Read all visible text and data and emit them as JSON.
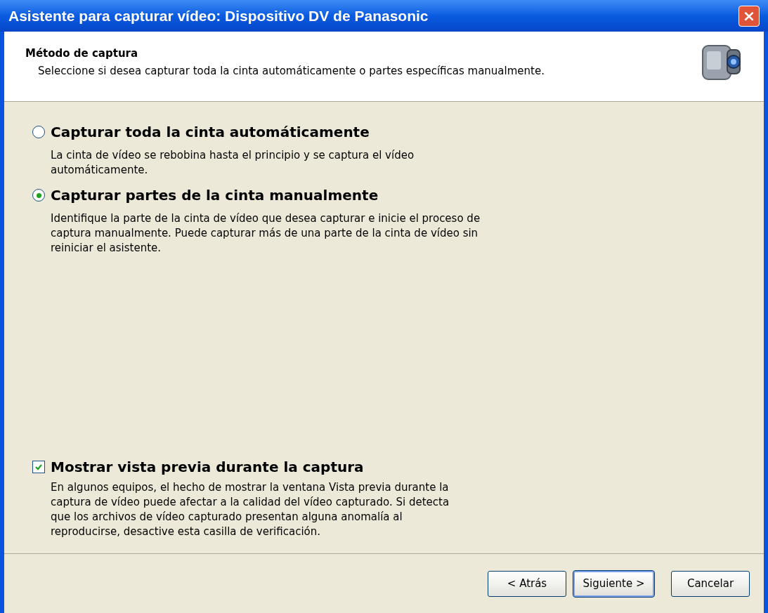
{
  "window": {
    "title": "Asistente para capturar vídeo: Dispositivo DV de Panasonic",
    "close": "×"
  },
  "header": {
    "title": "Método de captura",
    "subtitle": "Seleccione si desea capturar toda la cinta automáticamente o partes específicas manualmente."
  },
  "options": [
    {
      "label": "Capturar toda la cinta automáticamente",
      "description": "La cinta de vídeo se rebobina hasta el principio y se captura el vídeo automáticamente.",
      "selected": false
    },
    {
      "label": "Capturar partes de la cinta manualmente",
      "description": "Identifique la parte de la cinta de vídeo que desea capturar e inicie el proceso de captura manualmente. Puede capturar más de una parte de la cinta de vídeo sin reiniciar el asistente.",
      "selected": true
    }
  ],
  "preview": {
    "label": "Mostrar vista previa durante la captura",
    "description": "En algunos equipos, el hecho de mostrar la ventana Vista previa durante la captura de vídeo puede afectar a la calidad del vídeo capturado. Si detecta que los archivos de vídeo capturado presentan alguna anomalía al reproducirse, desactive esta casilla de verificación.",
    "checked": true
  },
  "buttons": [
    {
      "label": "< Atrás",
      "default": false
    },
    {
      "label": "Siguiente >",
      "default": true
    },
    {
      "label": "Cancelar",
      "default": false
    }
  ]
}
